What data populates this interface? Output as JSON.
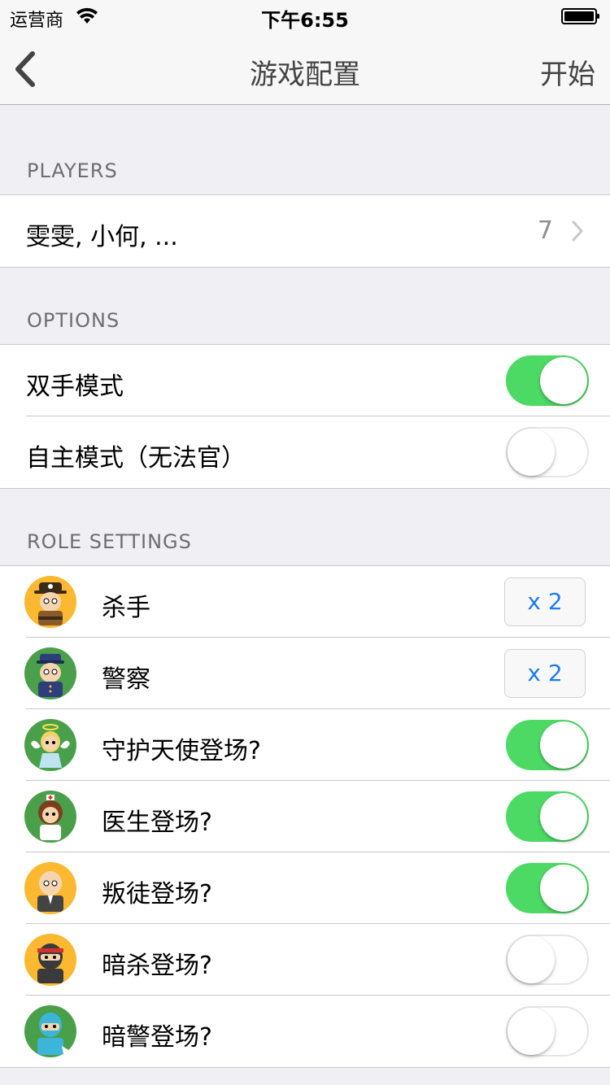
{
  "status": {
    "carrier": "运营商",
    "time": "下午6:55"
  },
  "nav": {
    "title": "游戏配置",
    "start_label": "开始"
  },
  "players": {
    "header": "PLAYERS",
    "names": "雯雯, 小何, ...",
    "count": "7"
  },
  "options": {
    "header": "OPTIONS",
    "items": [
      {
        "label": "双手模式",
        "on": true
      },
      {
        "label": "自主模式（无法官）",
        "on": false
      }
    ]
  },
  "roles": {
    "header": "ROLE SETTINGS",
    "items": [
      {
        "label": "杀手",
        "type": "count",
        "value": "x 2",
        "avatar": "killer-avatar",
        "bg": "#fbb830"
      },
      {
        "label": "警察",
        "type": "count",
        "value": "x 2",
        "avatar": "police-avatar",
        "bg": "#4a9f4a"
      },
      {
        "label": "守护天使登场?",
        "type": "toggle",
        "on": true,
        "avatar": "angel-avatar",
        "bg": "#4a9f4a"
      },
      {
        "label": "医生登场?",
        "type": "toggle",
        "on": true,
        "avatar": "doctor-avatar",
        "bg": "#4a9f4a"
      },
      {
        "label": "叛徒登场?",
        "type": "toggle",
        "on": true,
        "avatar": "traitor-avatar",
        "bg": "#fbb830"
      },
      {
        "label": "暗杀登场?",
        "type": "toggle",
        "on": false,
        "avatar": "assassin-avatar",
        "bg": "#fbb830"
      },
      {
        "label": "暗警登场?",
        "type": "toggle",
        "on": false,
        "avatar": "undercover-police-avatar",
        "bg": "#4a9f4a"
      }
    ]
  },
  "colors": {
    "toggle_on": "#4cd964",
    "accent": "#1a7cf5",
    "background": "#efeff4"
  }
}
